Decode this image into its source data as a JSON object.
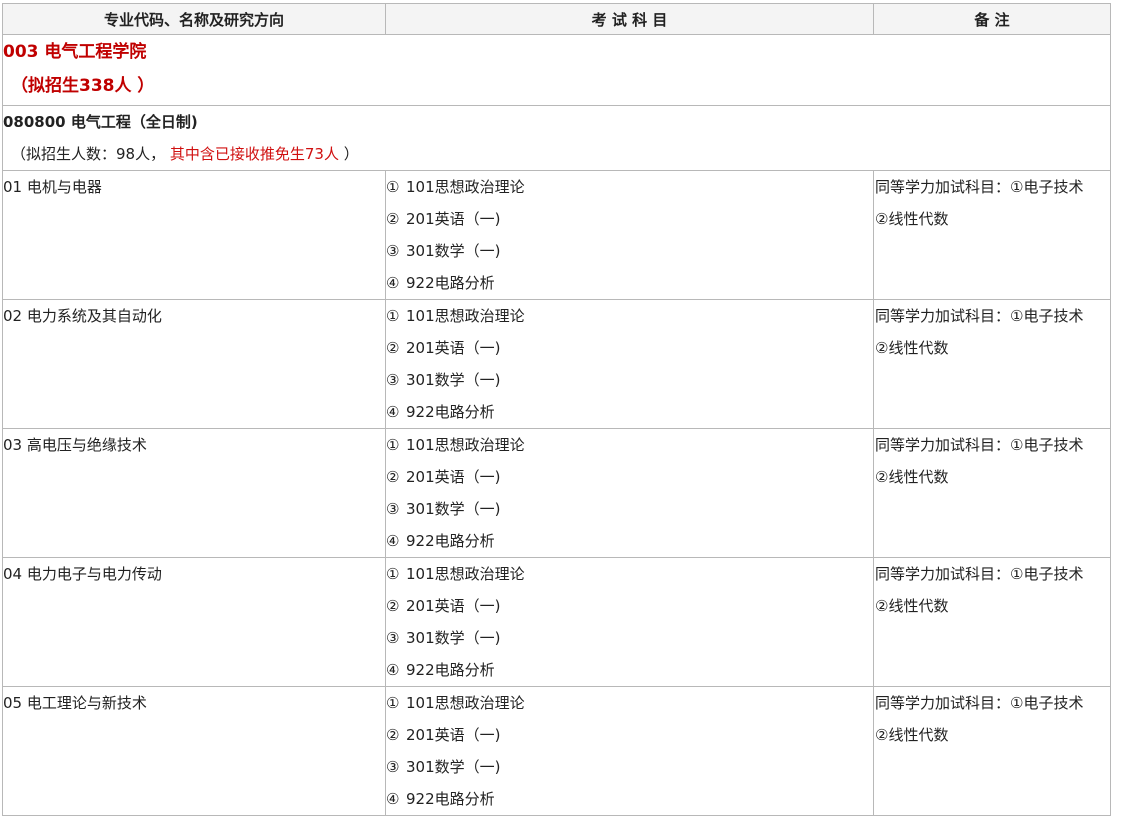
{
  "headers": {
    "col1": "专业代码、名称及研究方向",
    "col2": "考 试 科 目",
    "col3": "备 注"
  },
  "college": {
    "name": "003 电气工程学院",
    "quota": "（拟招生338人 ）"
  },
  "major": {
    "name": "080800 电气工程（全日制)",
    "quota_prefix": "（拟招生人数：98人，",
    "quota_exempt": "其中含已接收推免生73人",
    "quota_suffix": "）"
  },
  "directions": [
    {
      "name": "01 电机与电器",
      "subjects": [
        {
          "num": "①",
          "text": "101思想政治理论"
        },
        {
          "num": "②",
          "text": "201英语（一)"
        },
        {
          "num": "③",
          "text": "301数学（一)"
        },
        {
          "num": "④",
          "text": "922电路分析"
        }
      ],
      "note_line1": "同等学力加试科目：①电子技术",
      "note_line2": "②线性代数"
    },
    {
      "name": "02 电力系统及其自动化",
      "subjects": [
        {
          "num": "①",
          "text": "101思想政治理论"
        },
        {
          "num": "②",
          "text": "201英语（一)"
        },
        {
          "num": "③",
          "text": "301数学（一)"
        },
        {
          "num": "④",
          "text": "922电路分析"
        }
      ],
      "note_line1": "同等学力加试科目：①电子技术",
      "note_line2": "②线性代数"
    },
    {
      "name": "03 高电压与绝缘技术",
      "subjects": [
        {
          "num": "①",
          "text": "101思想政治理论"
        },
        {
          "num": "②",
          "text": "201英语（一)"
        },
        {
          "num": "③",
          "text": "301数学（一)"
        },
        {
          "num": "④",
          "text": "922电路分析"
        }
      ],
      "note_line1": "同等学力加试科目：①电子技术",
      "note_line2": "②线性代数"
    },
    {
      "name": "04 电力电子与电力传动",
      "subjects": [
        {
          "num": "①",
          "text": "101思想政治理论"
        },
        {
          "num": "②",
          "text": "201英语（一)"
        },
        {
          "num": "③",
          "text": "301数学（一)"
        },
        {
          "num": "④",
          "text": "922电路分析"
        }
      ],
      "note_line1": "同等学力加试科目：①电子技术",
      "note_line2": "②线性代数"
    },
    {
      "name": "05 电工理论与新技术",
      "subjects": [
        {
          "num": "①",
          "text": "101思想政治理论"
        },
        {
          "num": "②",
          "text": "201英语（一)"
        },
        {
          "num": "③",
          "text": "301数学（一)"
        },
        {
          "num": "④",
          "text": "922电路分析"
        }
      ],
      "note_line1": "同等学力加试科目：①电子技术",
      "note_line2": "②线性代数"
    }
  ]
}
